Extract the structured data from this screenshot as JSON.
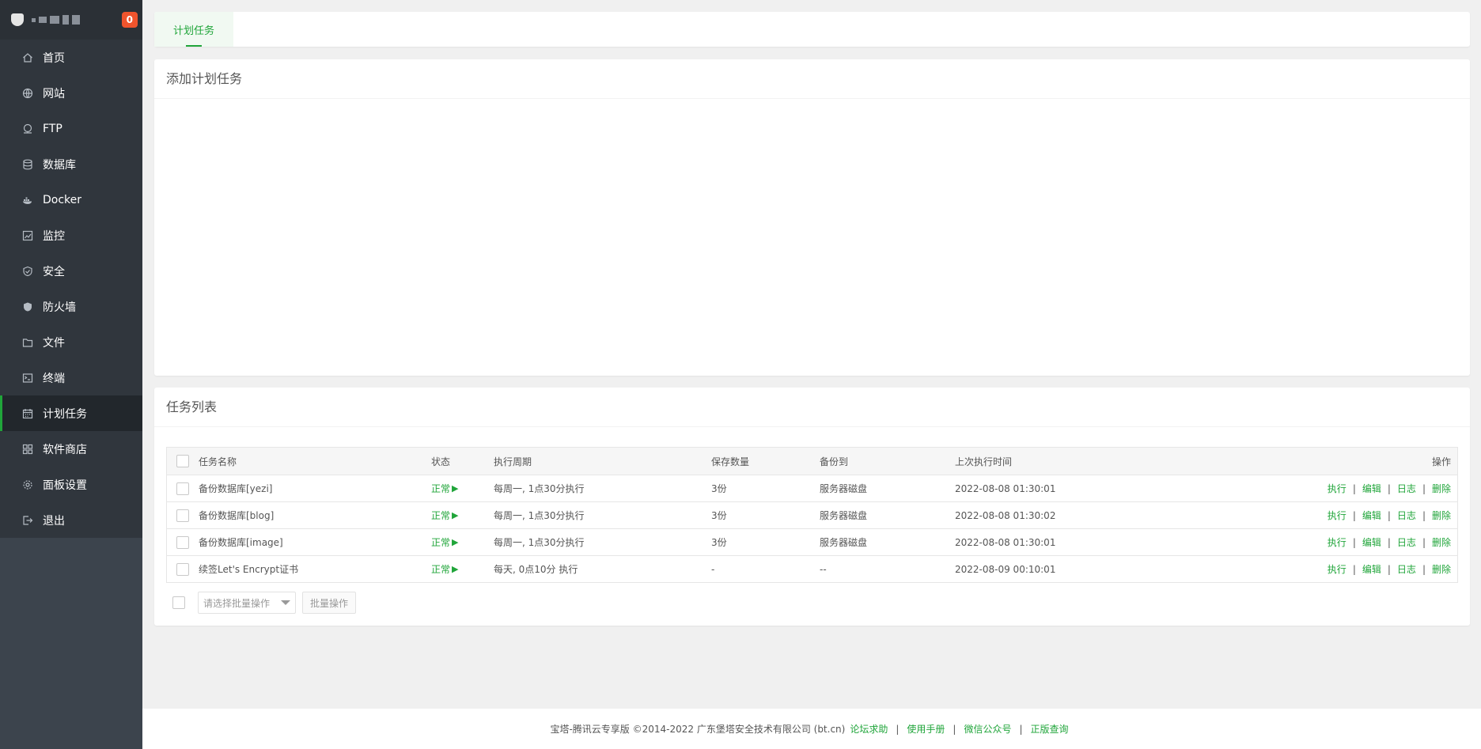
{
  "sidebar": {
    "badge": "0",
    "items": [
      {
        "label": "首页",
        "icon": "home-icon"
      },
      {
        "label": "网站",
        "icon": "globe-icon"
      },
      {
        "label": "FTP",
        "icon": "ftp-icon"
      },
      {
        "label": "数据库",
        "icon": "database-icon"
      },
      {
        "label": "Docker",
        "icon": "docker-icon"
      },
      {
        "label": "监控",
        "icon": "monitor-icon"
      },
      {
        "label": "安全",
        "icon": "shield-icon"
      },
      {
        "label": "防火墙",
        "icon": "firewall-icon"
      },
      {
        "label": "文件",
        "icon": "folder-icon"
      },
      {
        "label": "终端",
        "icon": "terminal-icon"
      },
      {
        "label": "计划任务",
        "icon": "calendar-icon",
        "active": true
      },
      {
        "label": "软件商店",
        "icon": "apps-icon"
      },
      {
        "label": "面板设置",
        "icon": "gear-icon"
      },
      {
        "label": "退出",
        "icon": "logout-icon"
      }
    ]
  },
  "tabbar": {
    "tab_label": "计划任务"
  },
  "add_panel": {
    "title": "添加计划任务"
  },
  "list_panel": {
    "title": "任务列表",
    "columns": {
      "name": "任务名称",
      "status": "状态",
      "cycle": "执行周期",
      "keep": "保存数量",
      "dest": "备份到",
      "last": "上次执行时间",
      "ops": "操作"
    },
    "rows": [
      {
        "name": "备份数据库[yezi]",
        "status": "正常",
        "cycle": "每周一, 1点30分执行",
        "keep": "3份",
        "dest": "服务器磁盘",
        "last": "2022-08-08 01:30:01"
      },
      {
        "name": "备份数据库[blog]",
        "status": "正常",
        "cycle": "每周一, 1点30分执行",
        "keep": "3份",
        "dest": "服务器磁盘",
        "last": "2022-08-08 01:30:02"
      },
      {
        "name": "备份数据库[image]",
        "status": "正常",
        "cycle": "每周一, 1点30分执行",
        "keep": "3份",
        "dest": "服务器磁盘",
        "last": "2022-08-08 01:30:01"
      },
      {
        "name": "续签Let's Encrypt证书",
        "status": "正常",
        "cycle": "每天, 0点10分 执行",
        "keep": "-",
        "dest": "--",
        "last": "2022-08-09 00:10:01"
      }
    ],
    "ops": {
      "run": "执行",
      "edit": "编辑",
      "log": "日志",
      "delete": "删除",
      "separator": "|"
    },
    "batch_placeholder": "请选择批量操作",
    "batch_button": "批量操作"
  },
  "footer": {
    "copyright": "宝塔-腾讯云专享版 ©2014-2022 广东堡塔安全技术有限公司 (bt.cn)",
    "links": [
      "论坛求助",
      "使用手册",
      "微信公众号",
      "正版查询"
    ],
    "separator": "|"
  },
  "colors": {
    "accent": "#20a53a",
    "sidebar_bg": "#3c444d",
    "badge": "#f0542d"
  }
}
